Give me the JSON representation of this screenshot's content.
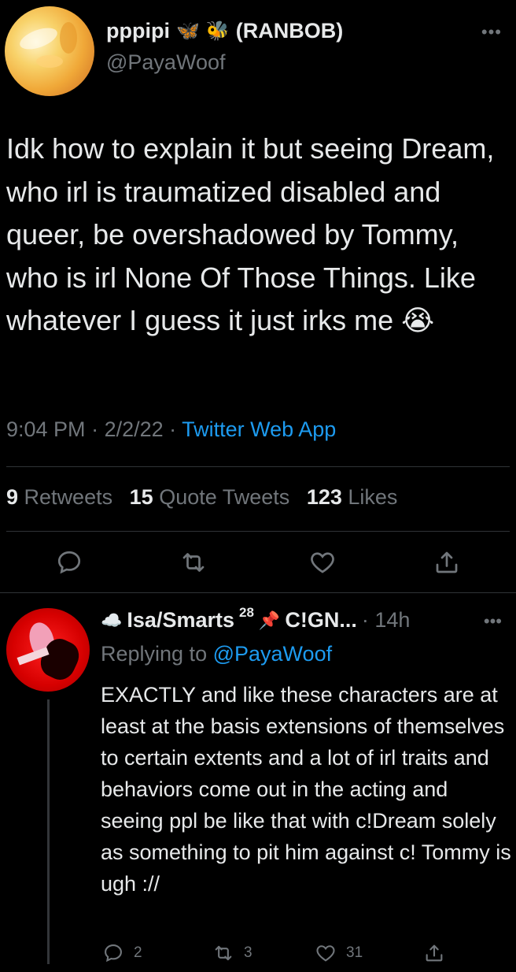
{
  "tweet": {
    "display_name": "pppipi",
    "name_suffix": "(RANBOB)",
    "emoji_1": "🦋",
    "emoji_2": "🐝",
    "handle": "@PayaWoof",
    "text": "Idk how to explain it but seeing Dream, who irl is traumatized disabled and queer, be overshadowed by Tommy, who is irl None Of Those Things. Like whatever I guess it just irks me 😭",
    "time": "9:04 PM",
    "date": "2/2/22",
    "source": "Twitter Web App",
    "separator": " · ",
    "stats": {
      "retweets_count": "9",
      "retweets_label": "Retweets",
      "quotes_count": "15",
      "quotes_label": "Quote Tweets",
      "likes_count": "123",
      "likes_label": "Likes"
    },
    "actions": [
      "reply-icon",
      "retweet-icon",
      "like-icon",
      "share-icon"
    ]
  },
  "reply": {
    "emoji_cloud": "☁️",
    "display_name": "Isa/Smarts",
    "sup": "28",
    "emoji_pin": "📌",
    "name_suffix": "C!GN...",
    "time": "· 14h",
    "replying_label": "Replying to",
    "replying_to": "@PayaWoof",
    "text": "EXACTLY and like these characters are at least at the basis extensions of themselves to certain extents and a lot of irl traits and behaviors come out in the acting and seeing ppl be like that with c!Dream solely as something to pit him against c! Tommy is ugh ://",
    "reply_count": "2",
    "retweet_count": "3",
    "like_count": "31"
  },
  "colors": {
    "background": "#000000",
    "text": "#e7e9ea",
    "muted": "#71767b",
    "link": "#1d9bf0",
    "divider": "#2f3336"
  }
}
